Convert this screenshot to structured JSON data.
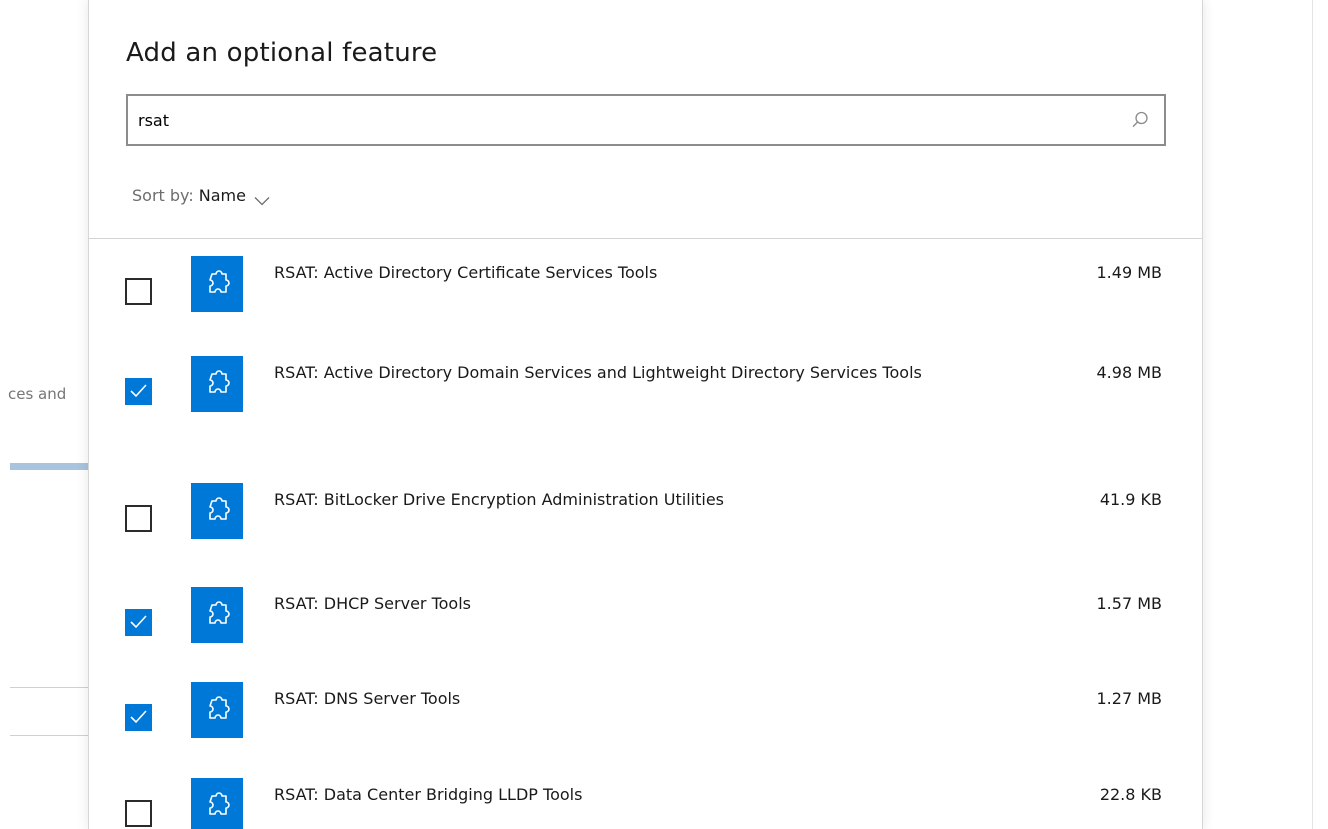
{
  "background": {
    "left_text": "ces and"
  },
  "dialog": {
    "title": "Add an optional feature",
    "search": {
      "value": "rsat",
      "icon": "search-icon"
    },
    "sort": {
      "label": "Sort by:",
      "value": "Name",
      "icon": "chevron-down-icon"
    },
    "features": [
      {
        "name": "RSAT: Active Directory Certificate Services Tools",
        "size": "1.49 MB",
        "checked": false
      },
      {
        "name": "RSAT: Active Directory Domain Services and Lightweight Directory Services Tools",
        "size": "4.98 MB",
        "checked": true
      },
      {
        "name": "RSAT: BitLocker Drive Encryption Administration Utilities",
        "size": "41.9 KB",
        "checked": false
      },
      {
        "name": "RSAT: DHCP Server Tools",
        "size": "1.57 MB",
        "checked": true
      },
      {
        "name": "RSAT: DNS Server Tools",
        "size": "1.27 MB",
        "checked": true
      },
      {
        "name": "RSAT: Data Center Bridging LLDP Tools",
        "size": "22.8 KB",
        "checked": false
      }
    ],
    "colors": {
      "accent": "#0078d7"
    }
  }
}
